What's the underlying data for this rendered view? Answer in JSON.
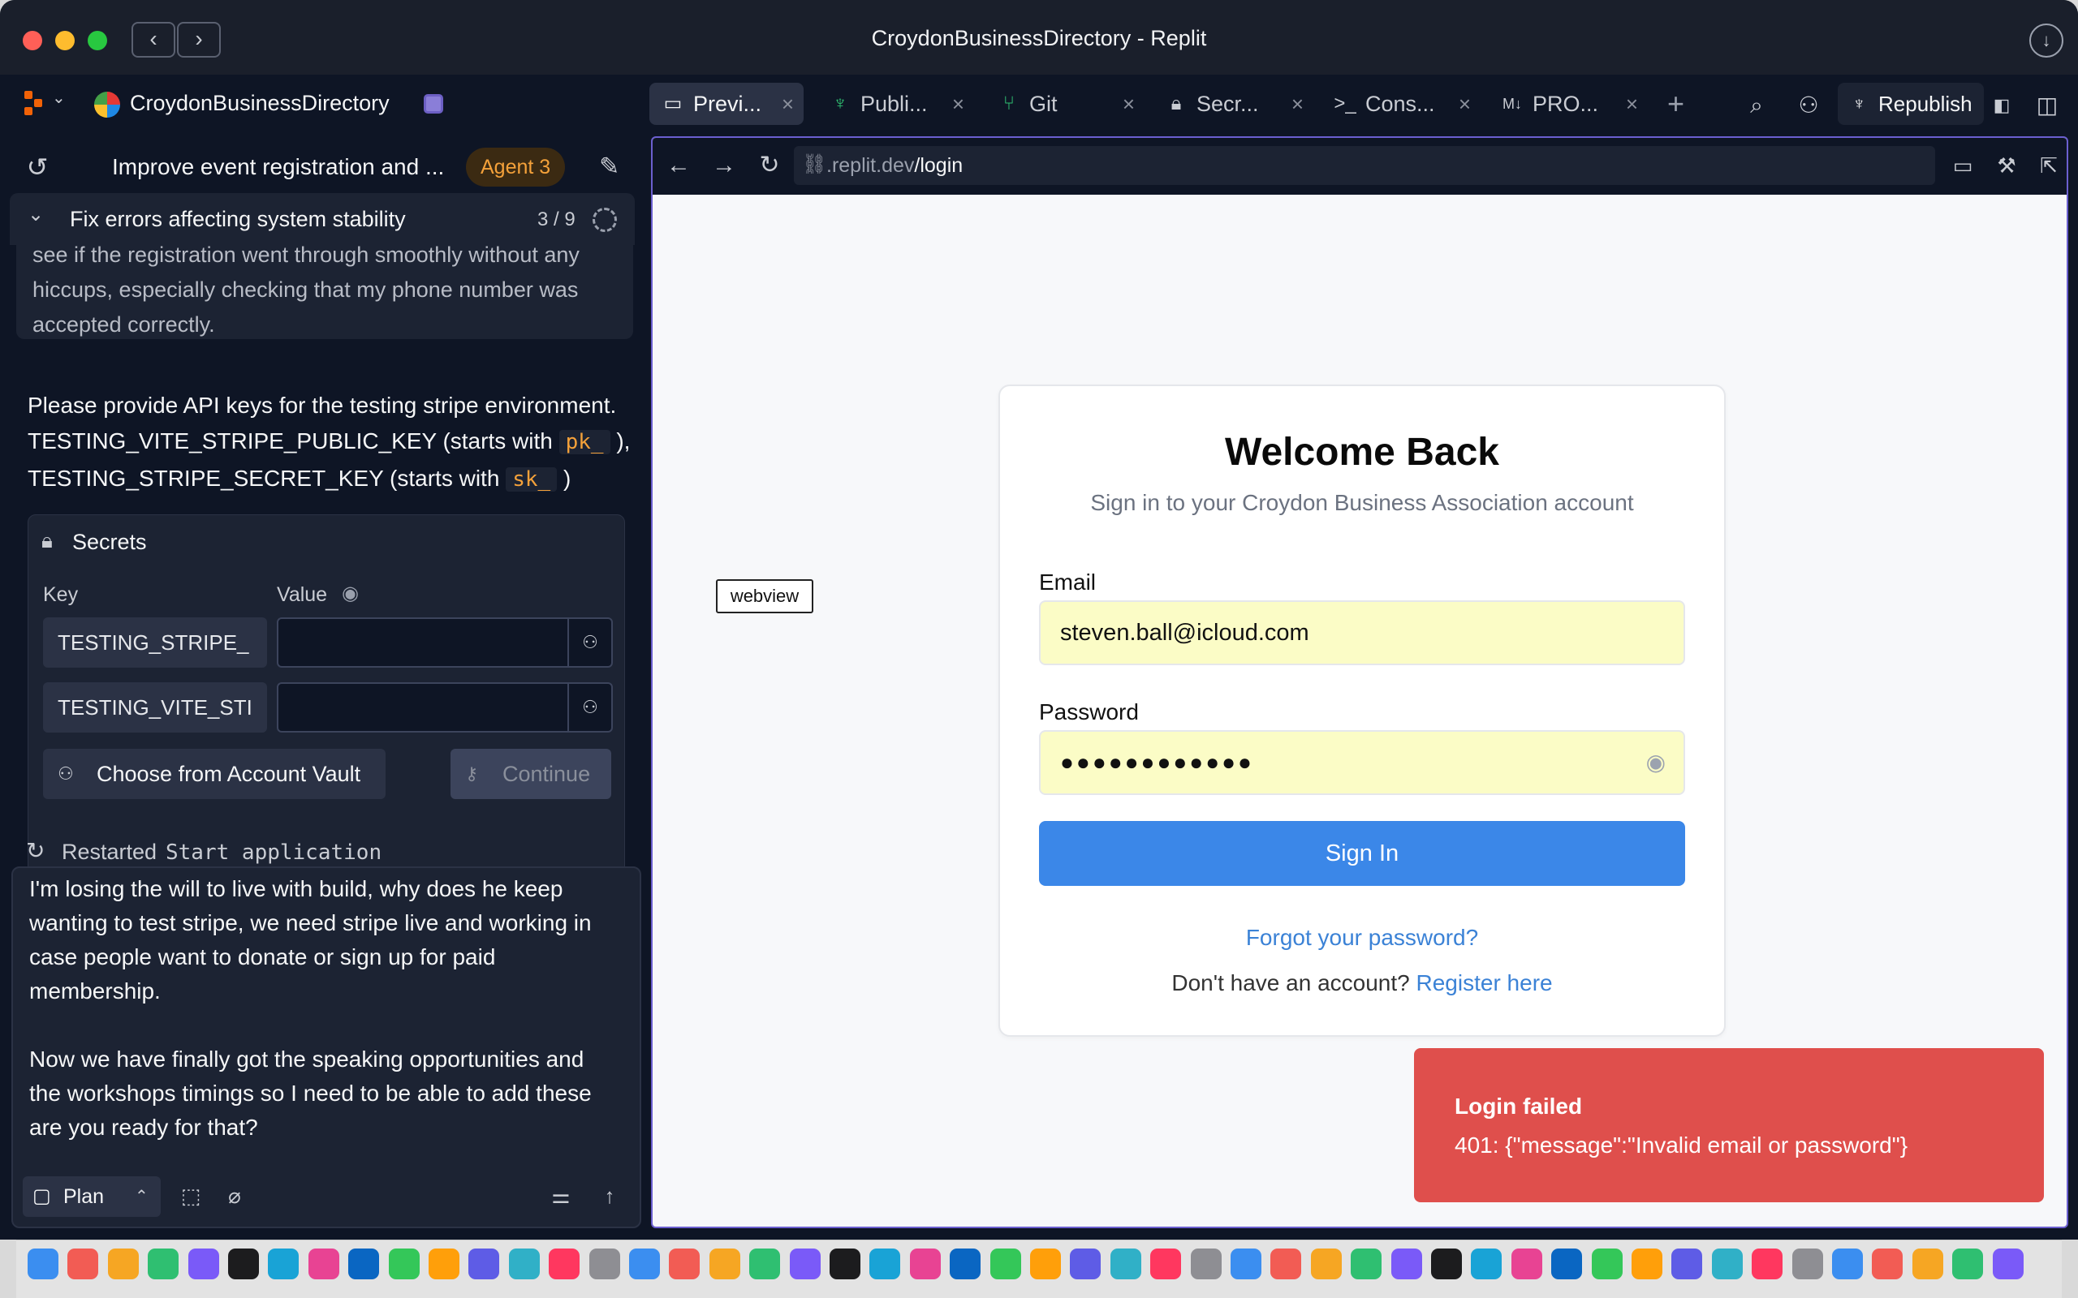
{
  "window": {
    "title": "CroydonBusinessDirectory - Replit"
  },
  "header": {
    "project_name": "CroydonBusinessDirectory",
    "tabs": [
      {
        "label": "Previ...",
        "icon": "monitor-icon",
        "active": true
      },
      {
        "label": "Publi...",
        "icon": "publish-icon"
      },
      {
        "label": "Git",
        "icon": "git-icon"
      },
      {
        "label": "Secr...",
        "icon": "lock-icon"
      },
      {
        "label": "Cons...",
        "icon": "console-icon"
      },
      {
        "label": "PRO...",
        "icon": "markdown-icon"
      }
    ],
    "republish_label": "Republish"
  },
  "agent": {
    "thread_title": "Improve event registration and ...",
    "badge": "Agent 3",
    "task_title": "Fix errors affecting system stability",
    "task_count": "3 / 9",
    "prev_user_msg": [
      "see if the registration went through smoothly without any",
      "hiccups, especially checking that my phone number was",
      "accepted correctly."
    ],
    "agent_msg": {
      "line1": "Please provide API keys for the testing stripe environment.",
      "line2_pre": "TESTING_VITE_STRIPE_PUBLIC_KEY (starts with",
      "line2_code": "pk_",
      "line2_post": "),",
      "line3_pre": "TESTING_STRIPE_SECRET_KEY (starts with",
      "line3_code": "sk_",
      "line3_post": ")"
    },
    "secrets": {
      "title": "Secrets",
      "key_label": "Key",
      "value_label": "Value",
      "rows": [
        {
          "key": "TESTING_STRIPE_",
          "value": ""
        },
        {
          "key": "TESTING_VITE_STI",
          "value": ""
        }
      ],
      "vault_button": "Choose from Account Vault",
      "continue_button": "Continue"
    },
    "restart": {
      "label": "Restarted",
      "command": "Start application"
    },
    "composer": {
      "lines": [
        "I'm losing the will to live with build, why does he keep",
        "wanting to test stripe, we need stripe live and working in",
        "case people want to donate or sign up for paid",
        "membership.",
        "",
        "Now we have finally got the speaking opportunities and",
        "the workshops timings so I need to be able to add these",
        "are you ready for that?"
      ],
      "mode_label": "Plan"
    }
  },
  "preview": {
    "url_prefix": ".replit.dev",
    "url_path": "/login",
    "webview_tag": "webview",
    "login": {
      "title": "Welcome Back",
      "subtitle": "Sign in to your Croydon Business Association account",
      "email_label": "Email",
      "email_value": "steven.ball@icloud.com",
      "password_label": "Password",
      "password_dots": "●●●●●●●●●●●●",
      "signin_button": "Sign In",
      "forgot_link": "Forgot your password?",
      "register_prompt": "Don't have an account?",
      "register_link": "Register here"
    },
    "toast": {
      "title": "Login failed",
      "message": "401: {\"message\":\"Invalid email or password\"}"
    }
  },
  "colors": {
    "app_bg": "#0e1525",
    "panel": "#1c2333",
    "accent_orange": "#f4a13a",
    "signin_blue": "#3b87e8",
    "toast_red": "#df4f4c",
    "autofill_yellow": "#fbfcc6"
  }
}
